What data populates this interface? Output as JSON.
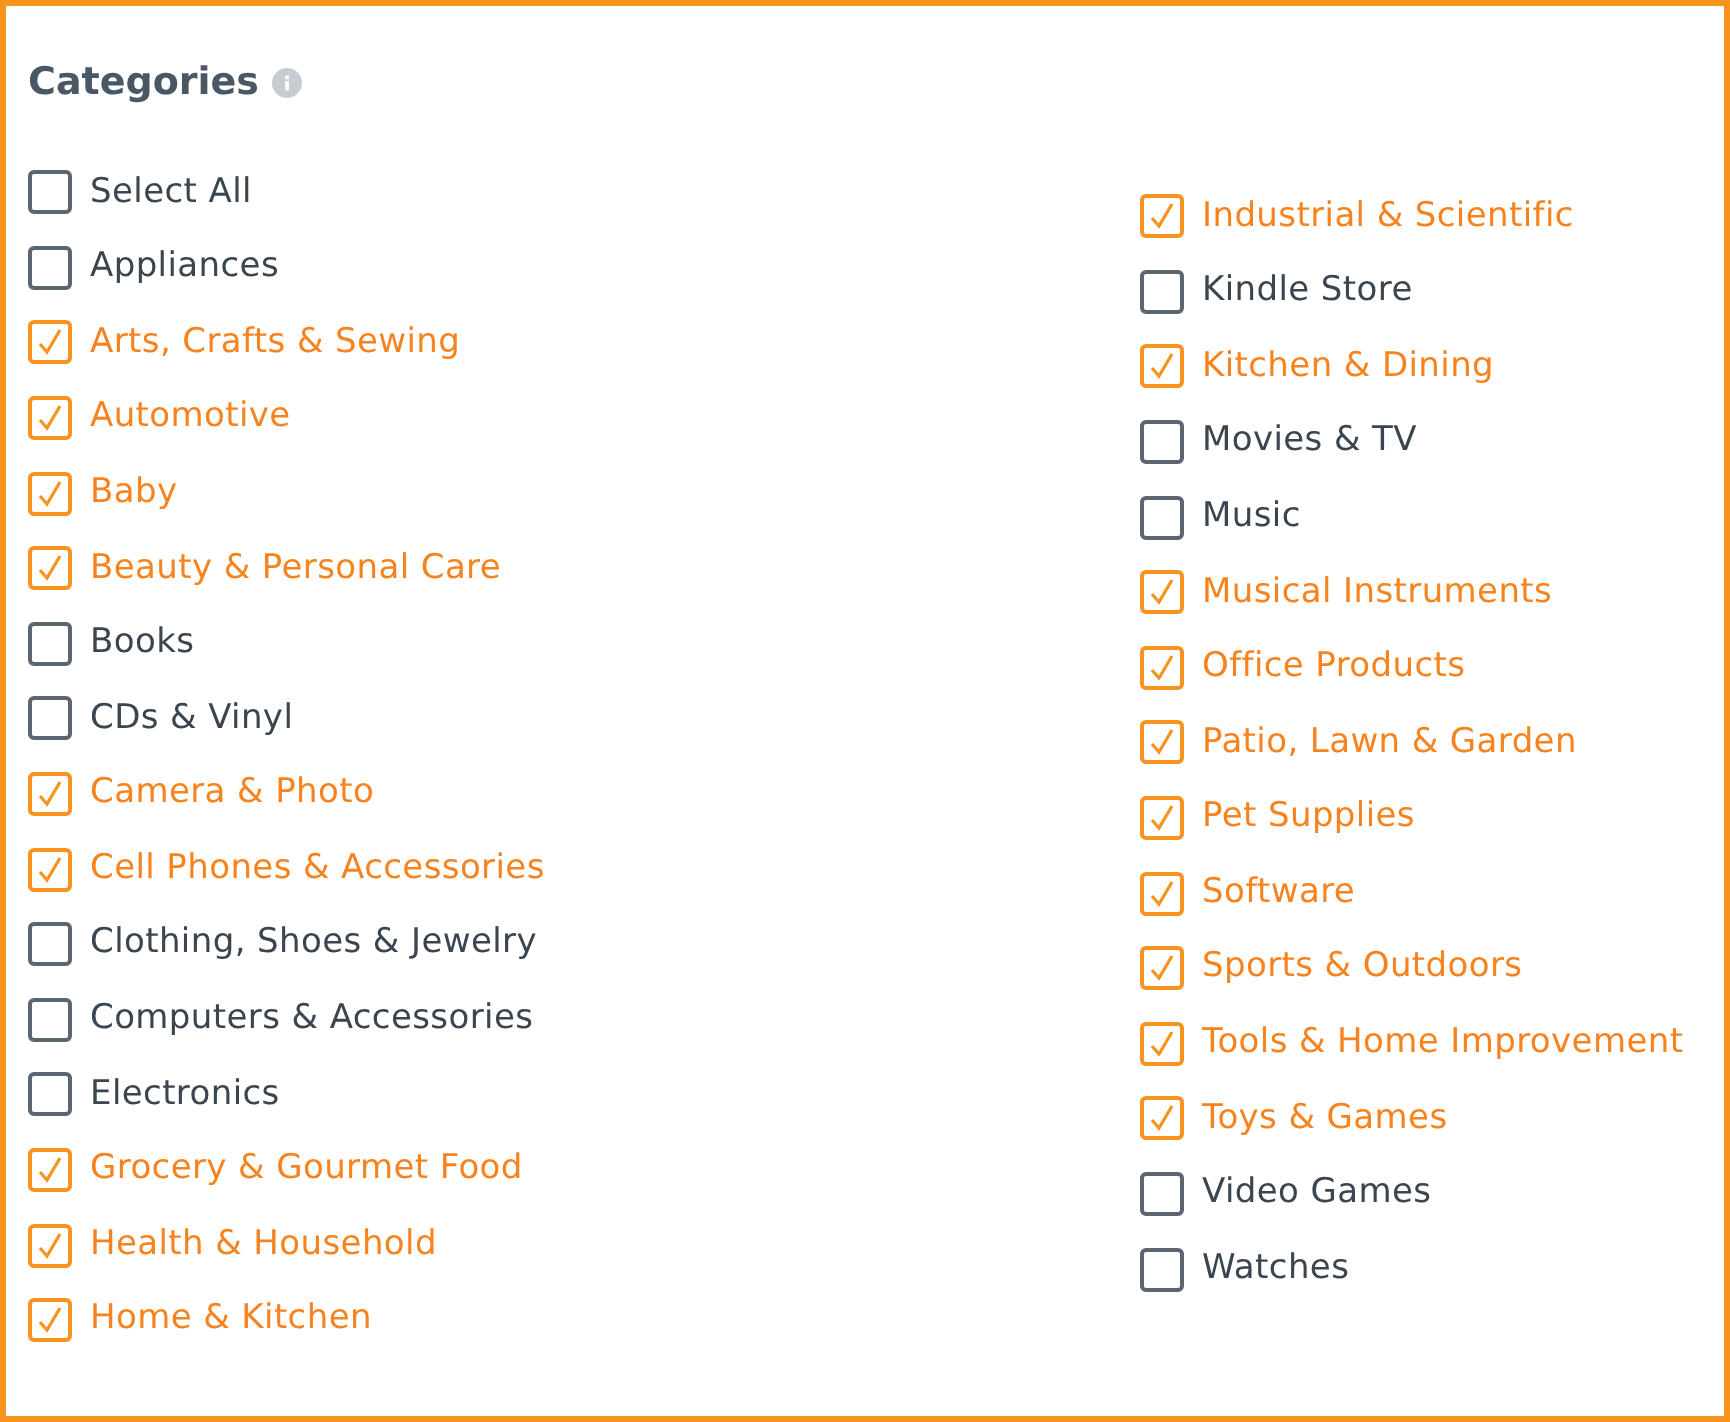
{
  "title": "Categories",
  "columns": [
    {
      "items": [
        {
          "label": "Select All",
          "checked": false
        },
        {
          "label": "Appliances",
          "checked": false
        },
        {
          "label": "Arts, Crafts & Sewing",
          "checked": true
        },
        {
          "label": "Automotive",
          "checked": true
        },
        {
          "label": "Baby",
          "checked": true
        },
        {
          "label": "Beauty & Personal Care",
          "checked": true
        },
        {
          "label": "Books",
          "checked": false
        },
        {
          "label": "CDs & Vinyl",
          "checked": false
        },
        {
          "label": "Camera & Photo",
          "checked": true
        },
        {
          "label": "Cell Phones & Accessories",
          "checked": true
        },
        {
          "label": "Clothing, Shoes & Jewelry",
          "checked": false
        },
        {
          "label": "Computers & Accessories",
          "checked": false
        },
        {
          "label": "Electronics",
          "checked": false
        },
        {
          "label": "Grocery & Gourmet Food",
          "checked": true
        },
        {
          "label": "Health & Household",
          "checked": true
        },
        {
          "label": "Home & Kitchen",
          "checked": true
        }
      ]
    },
    {
      "items": [
        {
          "label": "Industrial & Scientific",
          "checked": true
        },
        {
          "label": "Kindle Store",
          "checked": false
        },
        {
          "label": "Kitchen & Dining",
          "checked": true
        },
        {
          "label": "Movies & TV",
          "checked": false
        },
        {
          "label": "Music",
          "checked": false
        },
        {
          "label": "Musical Instruments",
          "checked": true
        },
        {
          "label": "Office Products",
          "checked": true
        },
        {
          "label": "Patio, Lawn & Garden",
          "checked": true
        },
        {
          "label": "Pet Supplies",
          "checked": true
        },
        {
          "label": "Software",
          "checked": true
        },
        {
          "label": "Sports & Outdoors",
          "checked": true
        },
        {
          "label": "Tools & Home Improvement",
          "checked": true
        },
        {
          "label": "Toys & Games",
          "checked": true
        },
        {
          "label": "Video Games",
          "checked": false
        },
        {
          "label": "Watches",
          "checked": false
        }
      ]
    }
  ]
}
